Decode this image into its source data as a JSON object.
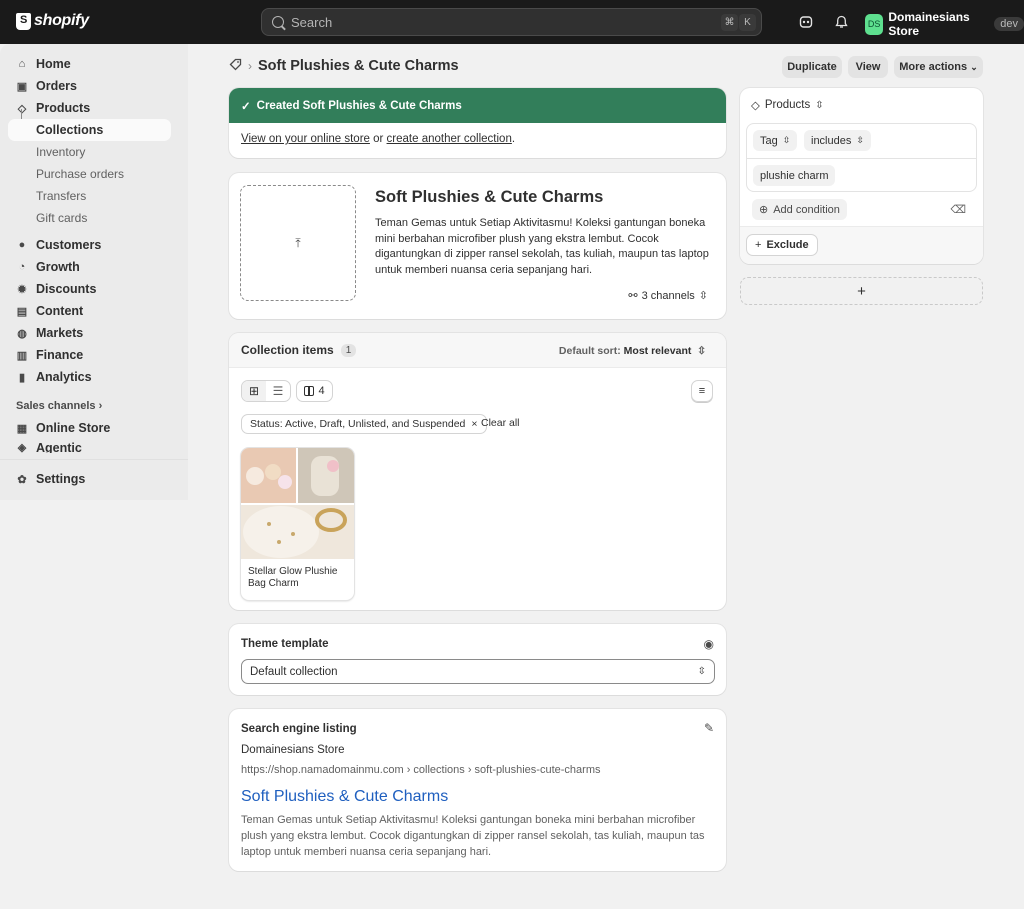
{
  "topbar": {
    "logo_text": "shopify",
    "search_placeholder": "Search",
    "shortcut_key1": "⌘",
    "shortcut_key2": "K",
    "store_initials": "DS",
    "store_name": "Domainesians Store",
    "store_badge": "dev"
  },
  "sidebar": {
    "home": "Home",
    "orders": "Orders",
    "products": "Products",
    "collections": "Collections",
    "inventory": "Inventory",
    "purchase_orders": "Purchase orders",
    "transfers": "Transfers",
    "gift_cards": "Gift cards",
    "customers": "Customers",
    "growth": "Growth",
    "discounts": "Discounts",
    "content": "Content",
    "markets": "Markets",
    "finance": "Finance",
    "analytics": "Analytics",
    "sales_channels": "Sales channels",
    "online_store": "Online Store",
    "agentic": "Agentic",
    "settings": "Settings"
  },
  "header": {
    "title": "Soft Plushies & Cute Charms",
    "duplicate": "Duplicate",
    "view": "View",
    "more_actions": "More actions"
  },
  "banner": {
    "message": "Created Soft Plushies & Cute Charms",
    "link1": "View on your online store",
    "or": " or ",
    "link2": "create another collection",
    "period": "."
  },
  "collection": {
    "title": "Soft Plushies & Cute Charms",
    "description": "Teman Gemas untuk Setiap Aktivitasmu! Koleksi gantungan boneka mini berbahan microfiber plush yang ekstra lembut. Cocok digantungkan di zipper ransel sekolah, tas kuliah, maupun tas laptop untuk memberi nuansa ceria sepanjang hari.",
    "channels": "3 channels"
  },
  "items": {
    "heading": "Collection items",
    "count": "1",
    "sort_label": "Default sort:",
    "sort_value": "Most relevant",
    "columns": "4",
    "filter_chip": "Status: Active, Draft, Unlisted, and Suspended",
    "clear_all": "Clear all",
    "product_name": "Stellar Glow Plushie Bag Charm"
  },
  "theme": {
    "heading": "Theme template",
    "value": "Default collection"
  },
  "seo": {
    "heading": "Search engine listing",
    "store": "Domainesians Store",
    "url": "https://shop.namadomainmu.com › collections › soft-plushies-cute-charms",
    "title": "Soft Plushies & Cute Charms",
    "description": "Teman Gemas untuk Setiap Aktivitasmu! Koleksi gantungan boneka mini berbahan microfiber plush yang ekstra lembut. Cocok digantungkan di zipper ransel sekolah, tas kuliah, maupun tas laptop untuk memberi nuansa ceria sepanjang hari."
  },
  "conditions": {
    "heading": "Products",
    "field": "Tag",
    "operator": "includes",
    "value": "plushie charm",
    "add_condition": "Add condition",
    "exclude": "Exclude",
    "add_block": "+"
  },
  "colors": {
    "accent_green": "#327e5a",
    "link_blue": "#1f5fbf",
    "topbar_bg": "#1a1a1a"
  }
}
